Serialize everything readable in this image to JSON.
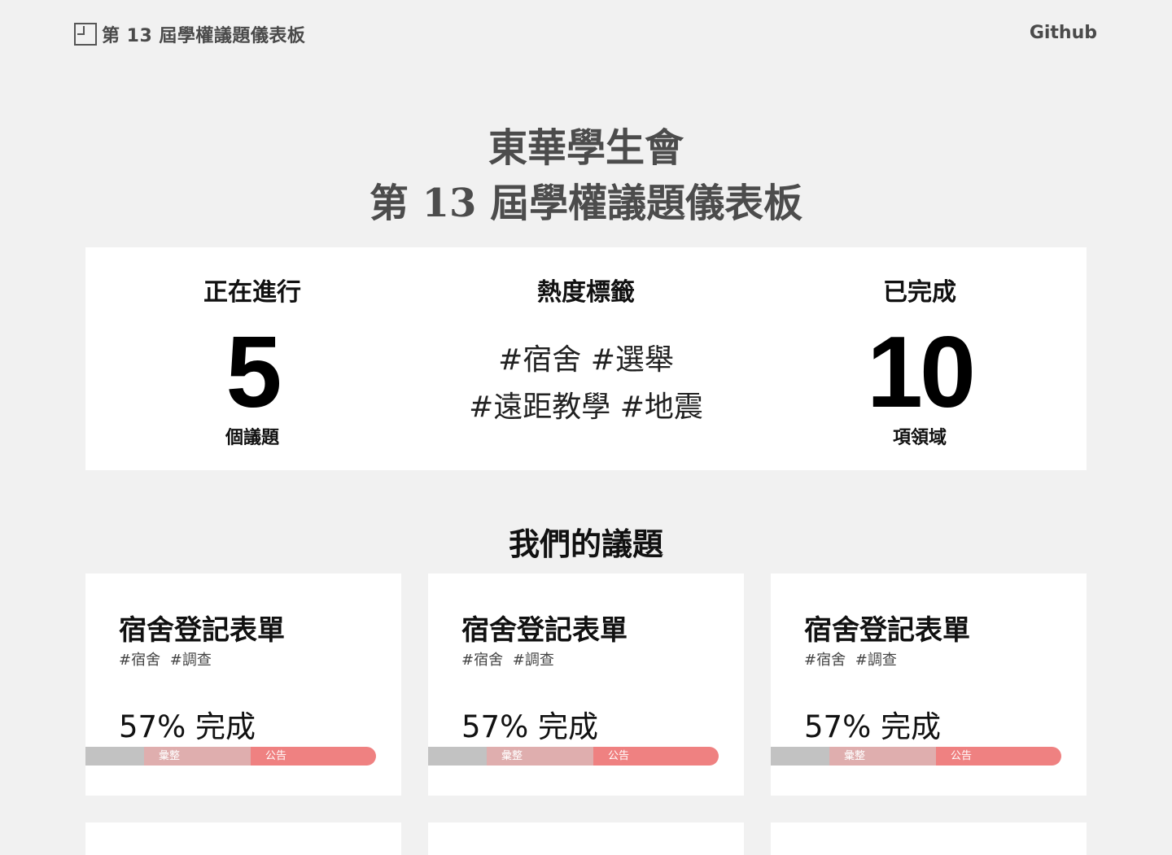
{
  "nav": {
    "brand": "第 13 屆學權議題儀表板",
    "github": "Github"
  },
  "hero": {
    "line1": "東華學生會",
    "line2": "第 13 屆學權議題儀表板"
  },
  "stats": {
    "ongoing": {
      "heading": "正在進行",
      "value": "5",
      "unit": "個議題"
    },
    "tags": {
      "heading": "熱度標籤",
      "line1": "#宿舍 #選舉",
      "line2": "#遠距教學 #地震"
    },
    "done": {
      "heading": "已完成",
      "value": "10",
      "unit": "項領域"
    }
  },
  "section": {
    "title": "我們的議題"
  },
  "issues": [
    {
      "title": "宿舍登記表單",
      "tags": "#宿舍 #調查",
      "progress": "57% 完成",
      "stage_a": "彙整",
      "stage_b": "公告"
    },
    {
      "title": "宿舍登記表單",
      "tags": "#宿舍 #調查",
      "progress": "57% 完成",
      "stage_a": "彙整",
      "stage_b": "公告"
    },
    {
      "title": "宿舍登記表單",
      "tags": "#宿舍 #調查",
      "progress": "57% 完成",
      "stage_a": "彙整",
      "stage_b": "公告"
    }
  ]
}
